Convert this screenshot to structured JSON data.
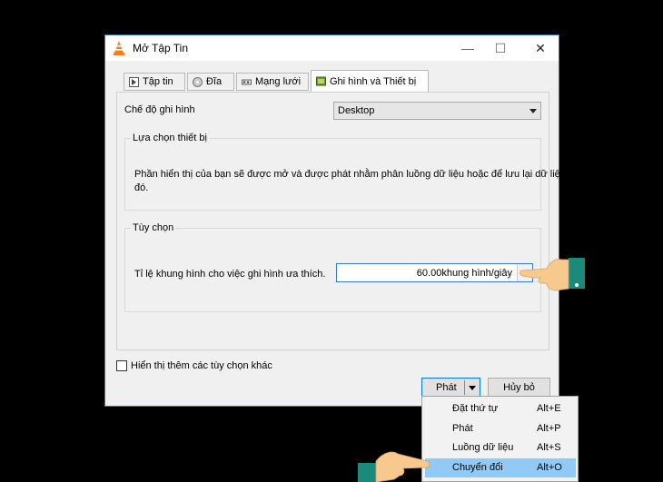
{
  "window": {
    "title": "Mở Tập Tin",
    "minimize_glyph": "—",
    "maximize_glyph": "☐",
    "close_glyph": "✕"
  },
  "tabs": [
    {
      "label": "Tập tin",
      "icon": "file-icon"
    },
    {
      "label": "Đĩa",
      "icon": "disc-icon"
    },
    {
      "label": "Mạng lưới",
      "icon": "network-icon"
    },
    {
      "label": "Ghi hình và Thiết bị",
      "icon": "capture-device-icon",
      "active": true
    }
  ],
  "capture_mode": {
    "label": "Chế độ ghi hình",
    "value": "Desktop"
  },
  "device_selection": {
    "title": "Lựa chọn thiết bị",
    "description_line1": "Phần hiển thị của bạn sẽ được mở và được phát nhằm phân luồng dữ liệu hoặc để lưu lại dữ liệu",
    "description_line2": "đó."
  },
  "options": {
    "title": "Tùy chọn",
    "frame_rate_label": "Tỉ lệ khung hình cho việc ghi hình ưa thích.",
    "frame_rate_value": "60.00khung hình/giây"
  },
  "show_more": {
    "label": "Hiển thị thêm các tùy chọn khác",
    "checked": false
  },
  "buttons": {
    "play": "Phát",
    "cancel": "Hủy bỏ"
  },
  "menu": [
    {
      "label": "Đặt thứ tự",
      "shortcut": "Alt+E"
    },
    {
      "label": "Phát",
      "shortcut": "Alt+P"
    },
    {
      "label": "Luồng dữ liệu",
      "shortcut": "Alt+S"
    },
    {
      "label": "Chuyển đổi",
      "shortcut": "Alt+O",
      "highlighted": true
    }
  ],
  "colors": {
    "accent": "#0078d7",
    "menu_highlight": "#91c9f7",
    "hand_cursor": "#f7c98f",
    "sleeve": "#1a8a7a"
  }
}
